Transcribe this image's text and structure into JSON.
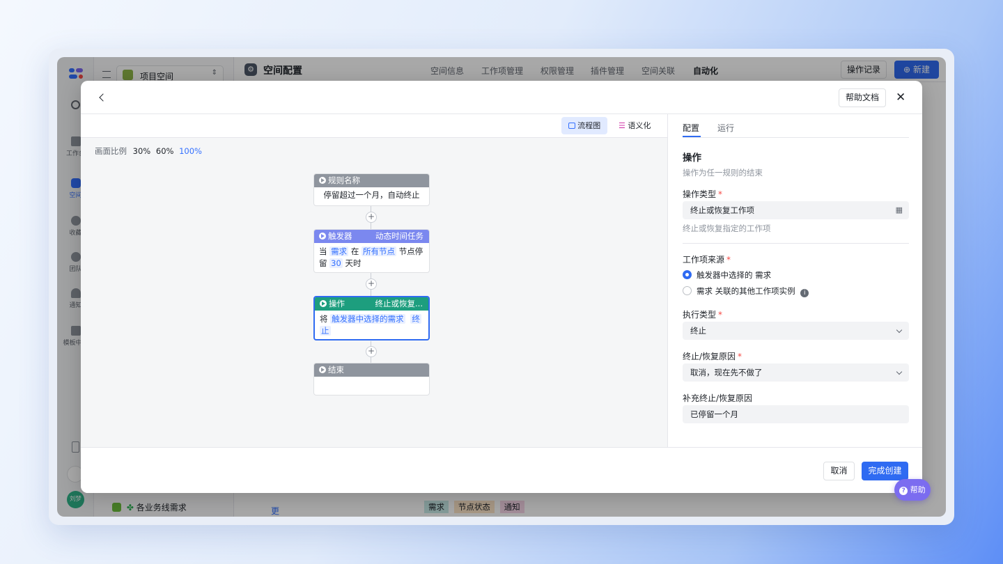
{
  "app": {
    "space_name": "项目空间",
    "page_title": "空间配置",
    "nav": [
      "空间信息",
      "工作项管理",
      "权限管理",
      "插件管理",
      "空间关联",
      "自动化"
    ],
    "op_log": "操作记录",
    "new_btn": "新建",
    "rail": [
      "工作台",
      "空间",
      "收藏",
      "团队",
      "通知",
      "模板中心"
    ],
    "user_avatar": "刘梦",
    "bottom_item": "各业务线需求",
    "more": "更多",
    "tags": [
      "需求",
      "节点状态",
      "通知"
    ]
  },
  "modal": {
    "help_doc": "帮助文档",
    "view_tabs": {
      "flow": "流程图",
      "semantic": "语义化"
    },
    "zoom": {
      "label": "画面比例",
      "options": [
        "30%",
        "60%",
        "100%"
      ],
      "active": "100%"
    },
    "nodes": {
      "rule": {
        "header": "规则名称",
        "body": "停留超过一个月，自动终止"
      },
      "trigger": {
        "header": "触发器",
        "type": "动态时间任务",
        "t1": "当",
        "tag1": "需求",
        "t2": "在",
        "tag2": "所有节点",
        "t3": "节点停",
        "t4": "留",
        "tag3": "30",
        "t5": "天时"
      },
      "action": {
        "header": "操作",
        "type": "终止或恢复...",
        "t1": "将",
        "tag1": "触发器中选择的需求",
        "tag2a": "终",
        "tag2b": "止"
      },
      "end": {
        "header": "结束"
      }
    },
    "panel": {
      "tabs": [
        "配置",
        "运行"
      ],
      "title": "操作",
      "desc": "操作为任一规则的结束",
      "op_type_label": "操作类型",
      "op_type_value": "终止或恢复工作项",
      "op_type_help": "终止或恢复指定的工作项",
      "source_label": "工作项来源",
      "source_opt1": "触发器中选择的 需求",
      "source_opt2": "需求 关联的其他工作项实例",
      "exec_label": "执行类型",
      "exec_value": "终止",
      "reason_label": "终止/恢复原因",
      "reason_value": "取消，现在先不做了",
      "extra_label": "补充终止/恢复原因",
      "extra_value": "已停留一个月"
    },
    "cancel": "取消",
    "confirm": "完成创建",
    "help_float": "帮助"
  }
}
